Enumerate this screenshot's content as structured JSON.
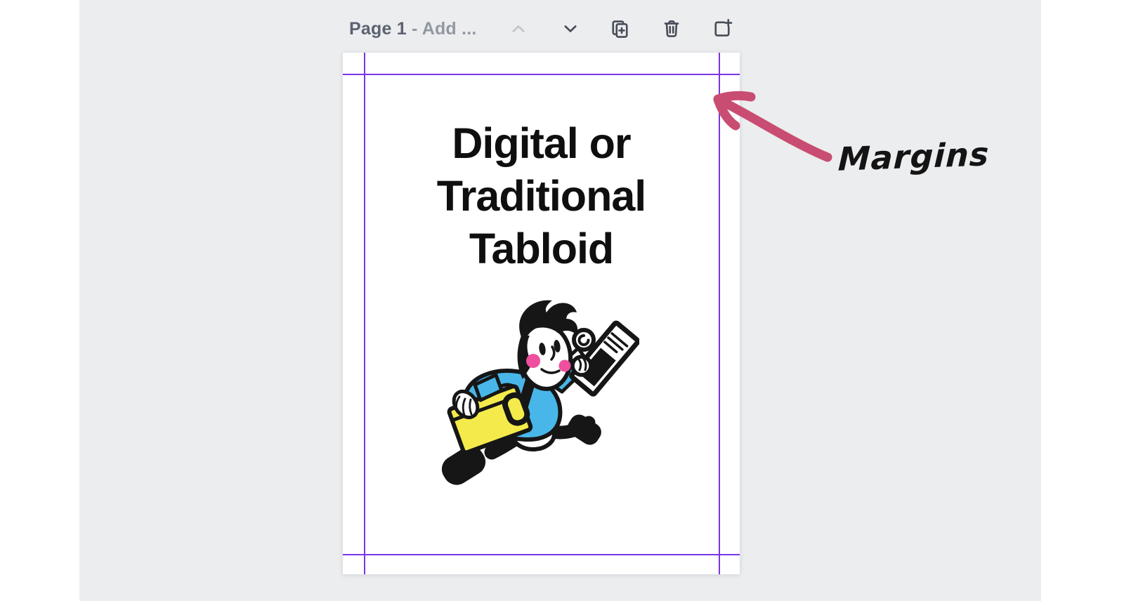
{
  "toolbar": {
    "page_label": "Page 1",
    "page_title_suffix": " - Add ...",
    "buttons": [
      {
        "name": "move-page-up",
        "icon": "chevron-up-icon",
        "disabled": true
      },
      {
        "name": "move-page-down",
        "icon": "chevron-down-icon",
        "disabled": false
      },
      {
        "name": "duplicate-page",
        "icon": "duplicate-page-icon",
        "disabled": false
      },
      {
        "name": "delete-page",
        "icon": "trash-icon",
        "disabled": false
      },
      {
        "name": "add-page",
        "icon": "add-page-icon",
        "disabled": false
      }
    ]
  },
  "page": {
    "title_lines": [
      "Digital or",
      "Traditional",
      "Tabloid"
    ],
    "illustration": "paperboy-running-with-newspaper"
  },
  "annotation": {
    "label": "Margins"
  },
  "colors": {
    "canvas-bg": "#ecedef",
    "panel-white": "#ffffff",
    "guide-purple": "#7b35e6",
    "arrow-pink": "#c94d72",
    "title-black": "#0f0f0f",
    "icon-gray": "#474d57",
    "icon-disabled": "#c2c6cc",
    "toolbar-text": "#5b6270",
    "toolbar-text-light": "#9298a1",
    "shirt-blue": "#49b6e9",
    "bag-yellow": "#f4ea4b",
    "cheek-pink": "#ee4f9e",
    "ink-black": "#161616"
  }
}
